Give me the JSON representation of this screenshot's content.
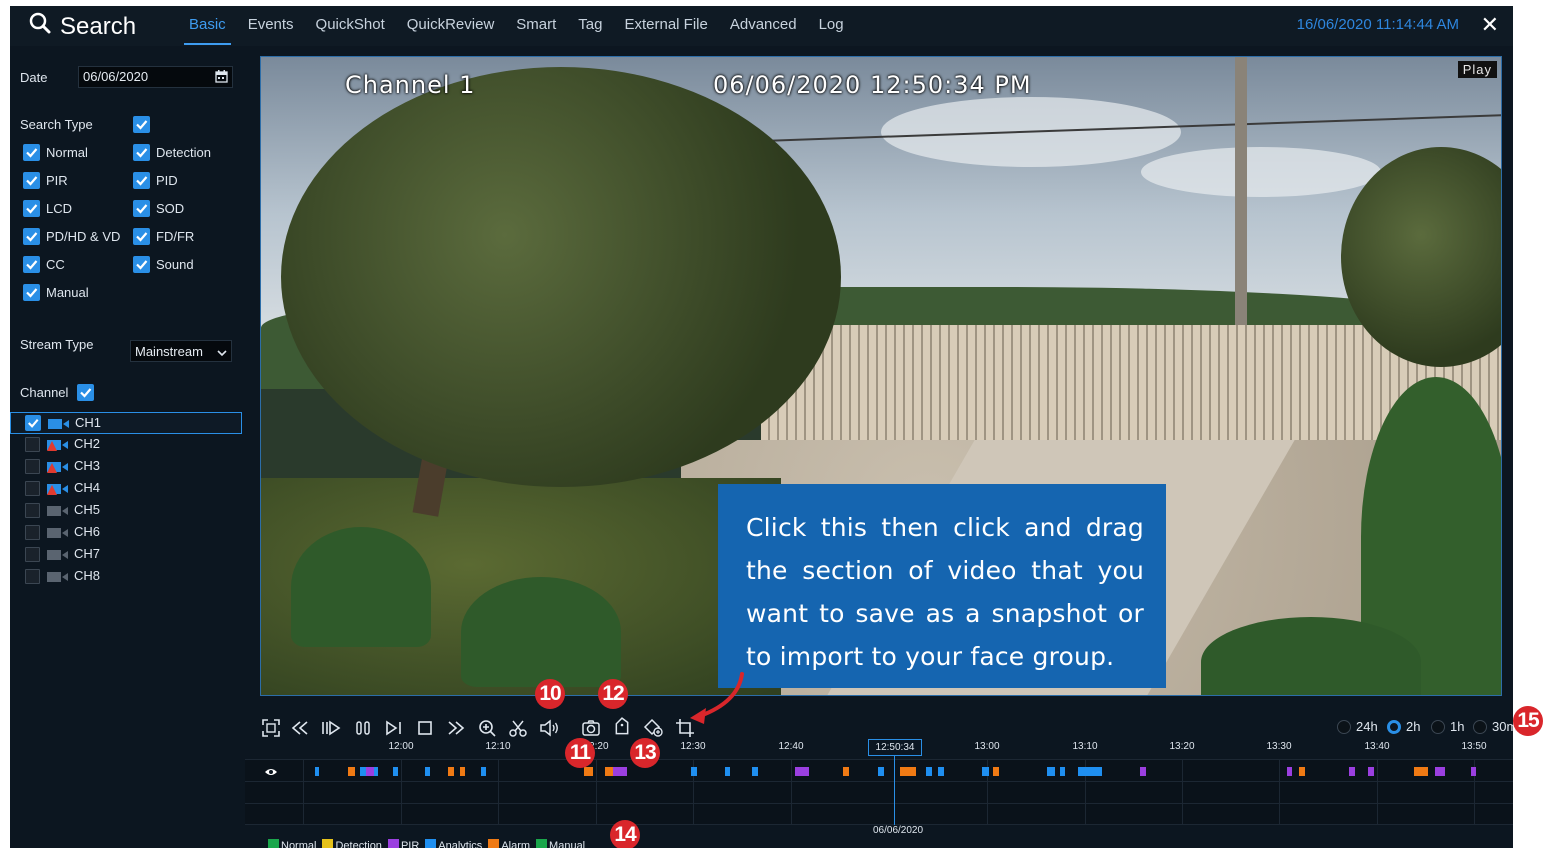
{
  "header": {
    "title": "Search",
    "tabs": [
      "Basic",
      "Events",
      "QuickShot",
      "QuickReview",
      "Smart",
      "Tag",
      "External File",
      "Advanced",
      "Log"
    ],
    "active_tab": "Basic",
    "datetime": "16/06/2020 11:14:44 AM",
    "close_glyph": "✕"
  },
  "sidebar": {
    "date_label": "Date",
    "date_value": "06/06/2020",
    "search_type_label": "Search Type",
    "search_types": [
      "Normal",
      "Detection",
      "PIR",
      "PID",
      "LCD",
      "SOD",
      "PD/HD & VD",
      "FD/FR",
      "CC",
      "Sound",
      "Manual"
    ],
    "stream_type_label": "Stream Type",
    "stream_type_value": "Mainstream",
    "channel_label": "Channel",
    "channels": [
      "CH1",
      "CH2",
      "CH3",
      "CH4",
      "CH5",
      "CH6",
      "CH7",
      "CH8"
    ],
    "selected_channel": "CH1"
  },
  "video": {
    "channel_overlay": "Channel 1",
    "timestamp_overlay": "06/06/2020 12:50:34 PM",
    "status": "Play"
  },
  "callout": {
    "text": "Click this then click and drag the section of video that you want to save as a snapshot or to import to your face group."
  },
  "badges": [
    "10",
    "11",
    "12",
    "13",
    "14",
    "15"
  ],
  "controls": {
    "icons": [
      "fullscreen-icon",
      "rewind-icon",
      "slow-play-icon",
      "pause-icon",
      "step-icon",
      "stop-icon",
      "fast-forward-icon",
      "zoom-icon",
      "clip-icon",
      "audio-icon",
      "snapshot-icon",
      "tag-icon",
      "custom-tag-icon",
      "crop-snapshot-icon"
    ],
    "ranges": [
      "24h",
      "2h",
      "1h",
      "30m"
    ],
    "selected_range": "2h"
  },
  "timeline": {
    "ticks": [
      "12:00",
      "12:10",
      "12:20",
      "12:30",
      "12:40",
      "12:50:34",
      "13:00",
      "13:10",
      "13:20",
      "13:30",
      "13:40",
      "13:50"
    ],
    "current_time": "12:50:34",
    "date": "06/06/2020",
    "legend": [
      {
        "label": "Normal",
        "color": "#1aa64b"
      },
      {
        "label": "Detection",
        "color": "#e6c21a"
      },
      {
        "label": "PIR",
        "color": "#9b3fe0"
      },
      {
        "label": "Analytics",
        "color": "#1f8ff0"
      },
      {
        "label": "Alarm",
        "color": "#f07a14"
      },
      {
        "label": "Manual",
        "color": "#1aa64b"
      }
    ]
  },
  "colors": {
    "accent": "#2a8fe6",
    "background": "#0c1620",
    "callout": "#1565b0",
    "badge": "#d9262b"
  }
}
